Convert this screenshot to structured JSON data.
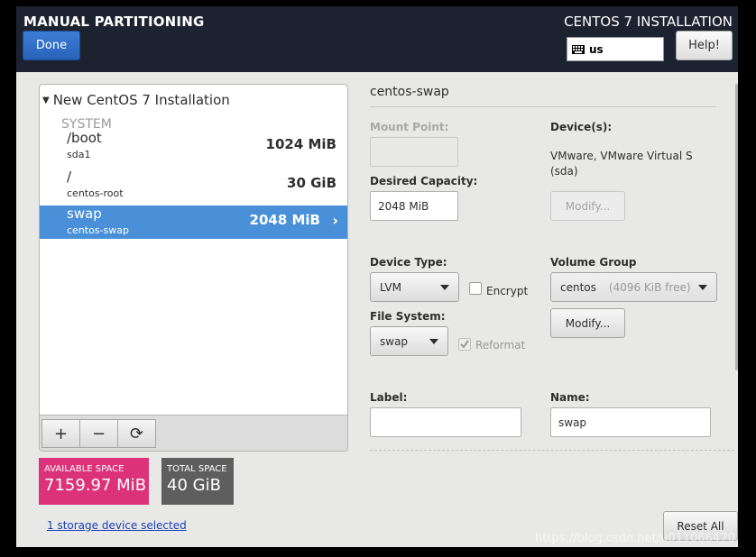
{
  "header": {
    "title": "MANUAL PARTITIONING",
    "installer_title": "CENTOS 7 INSTALLATION",
    "done_label": "Done",
    "keyboard_layout": "us",
    "help_label": "Help!"
  },
  "tree": {
    "heading": "New CentOS 7 Installation",
    "section": "SYSTEM",
    "items": [
      {
        "mount": "/boot",
        "device": "sda1",
        "size": "1024 MiB",
        "selected": false
      },
      {
        "mount": "/",
        "device": "centos-root",
        "size": "30 GiB",
        "selected": false
      },
      {
        "mount": "swap",
        "device": "centos-swap",
        "size": "2048 MiB",
        "selected": true
      }
    ],
    "toolbar": {
      "add": "+",
      "remove": "−",
      "refresh": "⟳"
    }
  },
  "space": {
    "available_label": "AVAILABLE SPACE",
    "available_value": "7159.97 MiB",
    "total_label": "TOTAL SPACE",
    "total_value": "40 GiB",
    "available_color": "#db3279",
    "total_color": "#5e5e5e"
  },
  "storage_link": "1 storage device selected",
  "details": {
    "title": "centos-swap",
    "mount_point_label": "Mount Point:",
    "mount_point_value": "",
    "desired_capacity_label": "Desired Capacity:",
    "desired_capacity_value": "2048 MiB",
    "devices_label": "Device(s):",
    "devices_line1": "VMware, VMware Virtual S",
    "devices_line2": "(sda)",
    "modify_devices_label": "Modify...",
    "device_type_label": "Device Type:",
    "device_type_value": "LVM",
    "encrypt_label": "Encrypt",
    "encrypt_checked": false,
    "volume_group_label": "Volume Group",
    "volume_group_name": "centos",
    "volume_group_free": "(4096 KiB free)",
    "modify_vg_label": "Modify...",
    "file_system_label": "File System:",
    "file_system_value": "swap",
    "reformat_label": "Reformat",
    "reformat_checked": true,
    "label_label": "Label:",
    "label_value": "",
    "name_label": "Name:",
    "name_value": "swap"
  },
  "reset_label": "Reset All",
  "watermark": "https://blog.csdn.net/u011066470",
  "colors": {
    "header_bg": "#1d2230",
    "selection": "#4a90d9",
    "done_button": "#2f6fc7"
  }
}
